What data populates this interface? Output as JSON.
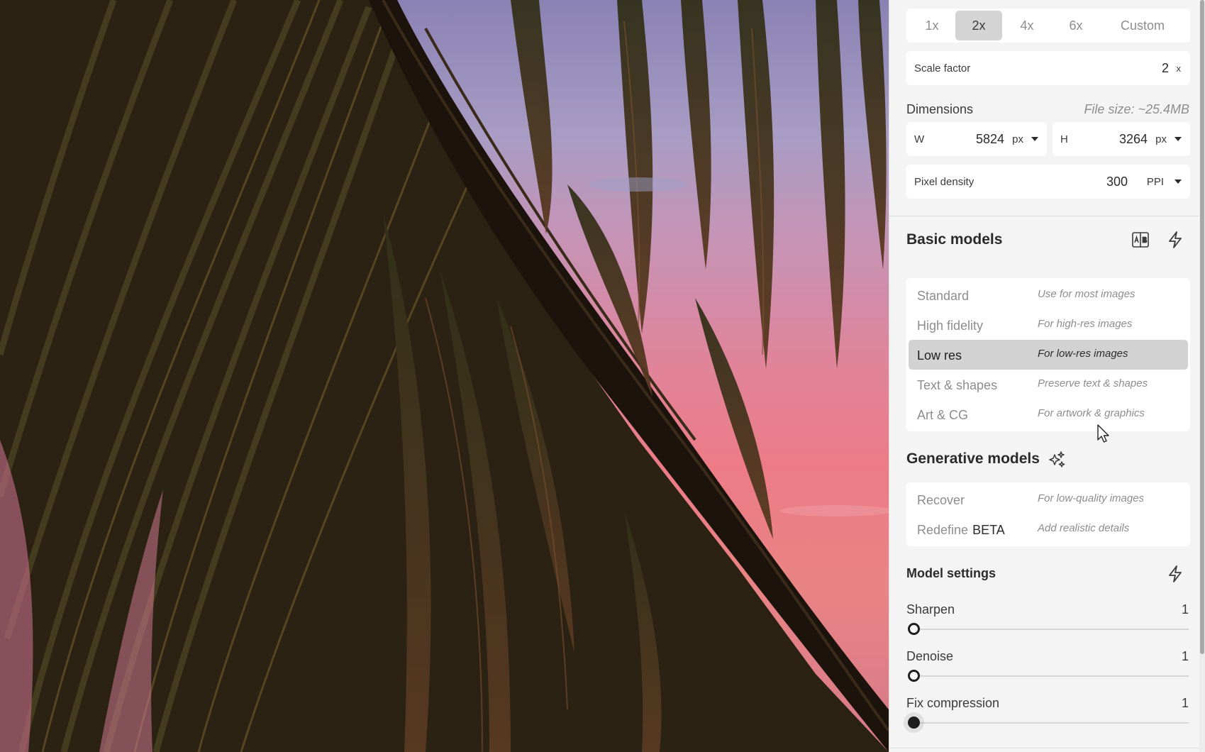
{
  "scale": {
    "options": [
      "1x",
      "2x",
      "4x",
      "6x",
      "Custom"
    ],
    "selected": "2x"
  },
  "scale_factor": {
    "label": "Scale factor",
    "value": "2",
    "unit": "x"
  },
  "dimensions": {
    "label": "Dimensions",
    "file_size": "File size: ~25.4MB",
    "width": {
      "label": "W",
      "value": "5824",
      "unit": "px"
    },
    "height": {
      "label": "H",
      "value": "3264",
      "unit": "px"
    }
  },
  "pixel_density": {
    "label": "Pixel density",
    "value": "300",
    "unit": "PPI"
  },
  "basic_models": {
    "title": "Basic models",
    "icons": [
      "compare-icon",
      "lightning-icon"
    ],
    "items": [
      {
        "name": "Standard",
        "desc": "Use for most images"
      },
      {
        "name": "High fidelity",
        "desc": "For high-res images"
      },
      {
        "name": "Low res",
        "desc": "For low-res images"
      },
      {
        "name": "Text & shapes",
        "desc": "Preserve text & shapes"
      },
      {
        "name": "Art & CG",
        "desc": "For artwork & graphics"
      }
    ],
    "selected": "Low res"
  },
  "generative_models": {
    "title": "Generative models",
    "icon": "sparkles-icon",
    "items": [
      {
        "name": "Recover",
        "desc": "For low-quality images"
      },
      {
        "name": "Redefine",
        "badge": "BETA",
        "desc": "Add realistic details"
      }
    ]
  },
  "model_settings": {
    "title": "Model settings",
    "icon": "lightning-icon",
    "sliders": [
      {
        "label": "Sharpen",
        "value": "1",
        "level": 0
      },
      {
        "label": "Denoise",
        "value": "1",
        "level": 0
      },
      {
        "label": "Fix compression",
        "value": "1",
        "level": 0
      }
    ]
  },
  "colors": {
    "panel_bg": "#f4f4f4",
    "selected_bg": "#d2d2d2",
    "accent": "#1e1e1e"
  }
}
